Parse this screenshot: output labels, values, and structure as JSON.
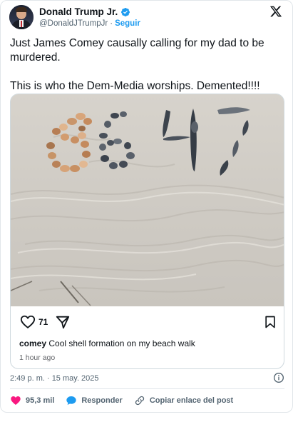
{
  "author": {
    "name": "Donald Trump Jr.",
    "handle": "@DonaldJTrumpJr",
    "separator": "·",
    "follow_label": "Seguir",
    "verified_color": "#1d9bf0",
    "avatar_icon": "avatar-photo"
  },
  "tweet": {
    "line1": "Just James Comey causally calling for my dad to be murdered.",
    "line2": "This is who the Dem-Media worships. Demented!!!!"
  },
  "embedded_post": {
    "image_description_icon": "sand-photo",
    "likes": "71",
    "caption_user": "comey",
    "caption_text": "Cool shell formation on my beach walk",
    "time_ago": "1 hour ago"
  },
  "timestamp": "2:49 p. m. · 15 may. 2025",
  "footer": {
    "likes_count": "95,3 mil",
    "reply_label": "Responder",
    "copy_link_label": "Copiar enlace del post",
    "heart_color": "#f91880",
    "reply_color": "#1d9bf0"
  }
}
